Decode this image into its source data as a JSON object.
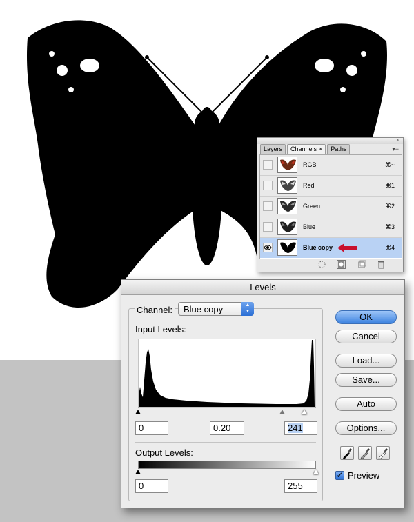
{
  "colors": {
    "accent": "#3d83e0",
    "selection": "#b9d2f4",
    "arrow": "#c8102e"
  },
  "channels_panel": {
    "tabs": [
      {
        "label": "Layers",
        "active": false
      },
      {
        "label": "Channels",
        "active": true
      },
      {
        "label": "Paths",
        "active": false
      }
    ],
    "close_glyph": "×",
    "menu_glyph": "▾≡",
    "rows": [
      {
        "name": "RGB",
        "shortcut": "⌘~",
        "visible": false,
        "selected": false
      },
      {
        "name": "Red",
        "shortcut": "⌘1",
        "visible": false,
        "selected": false
      },
      {
        "name": "Green",
        "shortcut": "⌘2",
        "visible": false,
        "selected": false
      },
      {
        "name": "Blue",
        "shortcut": "⌘3",
        "visible": false,
        "selected": false
      },
      {
        "name": "Blue copy",
        "shortcut": "⌘4",
        "visible": true,
        "selected": true
      }
    ],
    "footer_icons": [
      "dotted-circle-icon",
      "mask-icon",
      "new-channel-icon",
      "trash-icon"
    ]
  },
  "levels_dialog": {
    "title": "Levels",
    "channel_label": "Channel:",
    "channel_value": "Blue copy",
    "input_levels_label": "Input Levels:",
    "input_black": "0",
    "input_gamma": "0.20",
    "input_white": "241",
    "output_levels_label": "Output Levels:",
    "output_black": "0",
    "output_white": "255",
    "buttons": {
      "ok": "OK",
      "cancel": "Cancel",
      "load": "Load...",
      "save": "Save...",
      "auto": "Auto",
      "options": "Options..."
    },
    "preview_label": "Preview",
    "preview_checked": true,
    "eyedropper_icons": [
      "black-eyedropper-icon",
      "gray-eyedropper-icon",
      "white-eyedropper-icon"
    ]
  }
}
